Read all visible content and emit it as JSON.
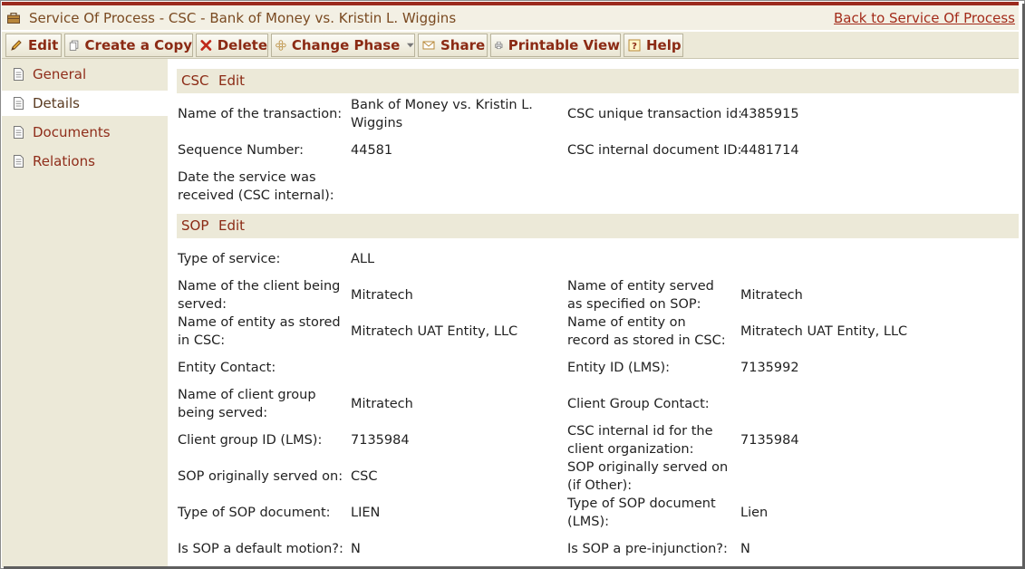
{
  "window": {
    "title": "Service Of Process - CSC - Bank of Money vs. Kristin L. Wiggins",
    "back_link": "Back to Service Of Process"
  },
  "toolbar": {
    "edit": "Edit",
    "copy": "Create a Copy",
    "delete": "Delete",
    "change_phase": "Change Phase",
    "share": "Share",
    "printable": "Printable View",
    "help": "Help"
  },
  "sidebar": {
    "items": [
      {
        "label": "General",
        "active": false
      },
      {
        "label": "Details",
        "active": true
      },
      {
        "label": "Documents",
        "active": false
      },
      {
        "label": "Relations",
        "active": false
      }
    ]
  },
  "csc": {
    "heading": "CSC",
    "edit": "Edit",
    "fields": {
      "transaction_name_label": "Name of the transaction:",
      "transaction_name_value": "Bank of Money vs. Kristin L. Wiggins",
      "unique_id_label": "CSC unique transaction id:",
      "unique_id_value": "4385915",
      "sequence_label": "Sequence Number:",
      "sequence_value": "44581",
      "internal_doc_label": "CSC internal document ID:",
      "internal_doc_value": "4481714",
      "date_received_label": "Date the service was received (CSC internal):",
      "date_received_value": ""
    }
  },
  "sop": {
    "heading": "SOP",
    "edit": "Edit",
    "fields": {
      "type_service_label": "Type of service:",
      "type_service_value": "ALL",
      "client_served_label": "Name of the client being served:",
      "client_served_value": "Mitratech",
      "entity_served_label": "Name of entity served as specified on SOP:",
      "entity_served_value": "Mitratech",
      "entity_stored_label": "Name of entity as stored in CSC:",
      "entity_stored_value": "Mitratech UAT Entity, LLC",
      "entity_record_label": "Name of entity on record as stored in CSC:",
      "entity_record_value": "Mitratech UAT Entity, LLC",
      "entity_contact_label": "Entity Contact:",
      "entity_contact_value": "",
      "entity_id_label": "Entity ID (LMS):",
      "entity_id_value": "7135992",
      "client_group_label": "Name of client group being served:",
      "client_group_value": "Mitratech",
      "client_group_contact_label": "Client Group Contact:",
      "client_group_contact_value": "",
      "client_group_id_label": "Client group ID (LMS):",
      "client_group_id_value": "7135984",
      "internal_org_label": "CSC internal id for the client organization:",
      "internal_org_value": "7135984",
      "orig_served_label": "SOP originally served on:",
      "orig_served_value": "CSC",
      "orig_served_other_label": "SOP originally served on (if Other):",
      "orig_served_other_value": "",
      "doc_type_label": "Type of SOP document:",
      "doc_type_value": "LIEN",
      "doc_type_lms_label": "Type of SOP document (LMS):",
      "doc_type_lms_value": "Lien",
      "default_motion_label": "Is SOP a default motion?:",
      "default_motion_value": "N",
      "pre_injunction_label": "Is SOP a pre-injunction?:",
      "pre_injunction_value": "N"
    }
  },
  "colors": {
    "accent": "#9b2a1e",
    "link": "#8b2a14",
    "panel": "#ece9d8",
    "title_bg": "#f3f0e4"
  }
}
